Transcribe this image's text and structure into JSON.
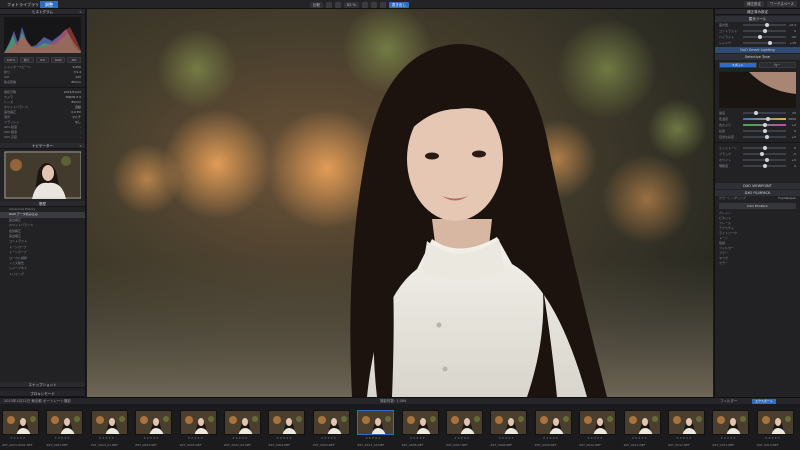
{
  "topbar": {
    "tab_library": "フォトライブラリ",
    "tab_develop": "調整",
    "compare_label": "比較",
    "zoom_label": "82 %",
    "export_label": "書き出し",
    "right_label": "補正設定",
    "right_label2": "ワークスペース"
  },
  "left_panel": {
    "histogram_title": "ヒストグラム",
    "info_rows": [
      {
        "k": "シャッタースピード",
        "v": "1/250"
      },
      {
        "k": "絞り",
        "v": "f/1.4"
      },
      {
        "k": "ISO",
        "v": "100"
      },
      {
        "k": "焦点距離",
        "v": "85mm"
      }
    ],
    "chips": [
      "100%",
      "絞り",
      "ISO",
      "RAW",
      "JPG"
    ],
    "meta_rows": [
      {
        "k": "撮影日時",
        "v": "2023/01/22"
      },
      {
        "k": "カメラ",
        "v": "NIKON Z 9"
      },
      {
        "k": "レンズ",
        "v": "85mm"
      },
      {
        "k": "ホワイトバランス",
        "v": "自動"
      },
      {
        "k": "露出補正",
        "v": "0.0 EV"
      },
      {
        "k": "測光",
        "v": "マルチ"
      },
      {
        "k": "フラッシュ",
        "v": "なし"
      },
      {
        "k": "GPS 緯度",
        "v": "-"
      },
      {
        "k": "GPS 経度",
        "v": "-"
      },
      {
        "k": "GPS 高度",
        "v": "-"
      }
    ],
    "navigator_title": "ナビゲーター",
    "history_title": "履歴",
    "history_items": [
      "Advanced History",
      "RAW データ読み込み",
      "露出補正",
      "ホワイトバランス",
      "色調補正",
      "露出補正",
      "コントラスト",
      "トーンカーブ",
      "トーンカーブ",
      "ローカル調整",
      "ノイズ除去",
      "シャープネス",
      "トリミング"
    ],
    "snapshot_title": "スナップショット",
    "bottom_label": "プロキシモード"
  },
  "right_panel": {
    "top_label": "補正済み設定",
    "section1": "露光ツール",
    "sliders1": [
      {
        "label": "露光量",
        "value": "+0.3",
        "pos": 0.55
      },
      {
        "label": "コントラスト",
        "value": "0",
        "pos": 0.5
      },
      {
        "label": "ハイライト",
        "value": "-20",
        "pos": 0.4
      },
      {
        "label": "シャドウ",
        "value": "+15",
        "pos": 0.62
      }
    ],
    "active_btn": "DxO Smart Lighting",
    "btn2": "Selective Tone",
    "toggle_a": "スポット",
    "toggle_b": "均一",
    "sliders2": [
      {
        "label": "強度",
        "value": "25",
        "pos": 0.3
      },
      {
        "label": "色温度",
        "value": "5600",
        "pos": 0.58
      },
      {
        "label": "色かぶり",
        "value": "+2",
        "pos": 0.52
      },
      {
        "label": "彩度",
        "value": "0",
        "pos": 0.5
      },
      {
        "label": "自然な彩度",
        "value": "+5",
        "pos": 0.56
      }
    ],
    "sliders3": [
      {
        "label": "ミッドトーン",
        "value": "0",
        "pos": 0.5
      },
      {
        "label": "ブラック",
        "value": "-5",
        "pos": 0.45
      },
      {
        "label": "ホワイト",
        "value": "+5",
        "pos": 0.55
      },
      {
        "label": "明瞭度",
        "value": "0",
        "pos": 0.5
      }
    ],
    "section_viewpoint": "DXO VIEWPOINT",
    "section_filmpack": "DXO FILMPACK",
    "filmpack_label": "カラーレンダリング",
    "filmpack_item": "Fuji Neopan",
    "filmpack_btn": "DxO FilmPack",
    "list_rows": [
      "グレイン",
      "ビネット",
      "フレーム",
      "テクスチャ",
      "ライトリーク",
      "トーン",
      "色調",
      "フィルター",
      "ブラー",
      "マスク",
      "カラー"
    ]
  },
  "filmstrip": {
    "path_label": "2023年1月22日 東京都 ポートレート撮影",
    "count_label": "撮影枚数: 1,084",
    "filter_label": "フィルター",
    "right_btn": "エクスポート",
    "thumbs": [
      "Z9T_2023-0001.NEF",
      "Z9T_0001.NEF",
      "Z9T_2023_01.NEF",
      "Z9T_0002.NEF",
      "Z9T_0003.NEF",
      "Z9T_2023_02.NEF",
      "Z9T_0004.NEF",
      "Z9T_0005.NEF",
      "Z9T_2023_03.NEF",
      "Z9T_0006.NEF",
      "Z9T_0007.NEF",
      "Z9T_0008.NEF",
      "Z9T_0009.NEF",
      "Z9T_0010.NEF",
      "Z9T_0011.NEF",
      "Z9T_0012.NEF",
      "Z9T_0013.NEF",
      "Z9T_0014.NEF"
    ]
  }
}
